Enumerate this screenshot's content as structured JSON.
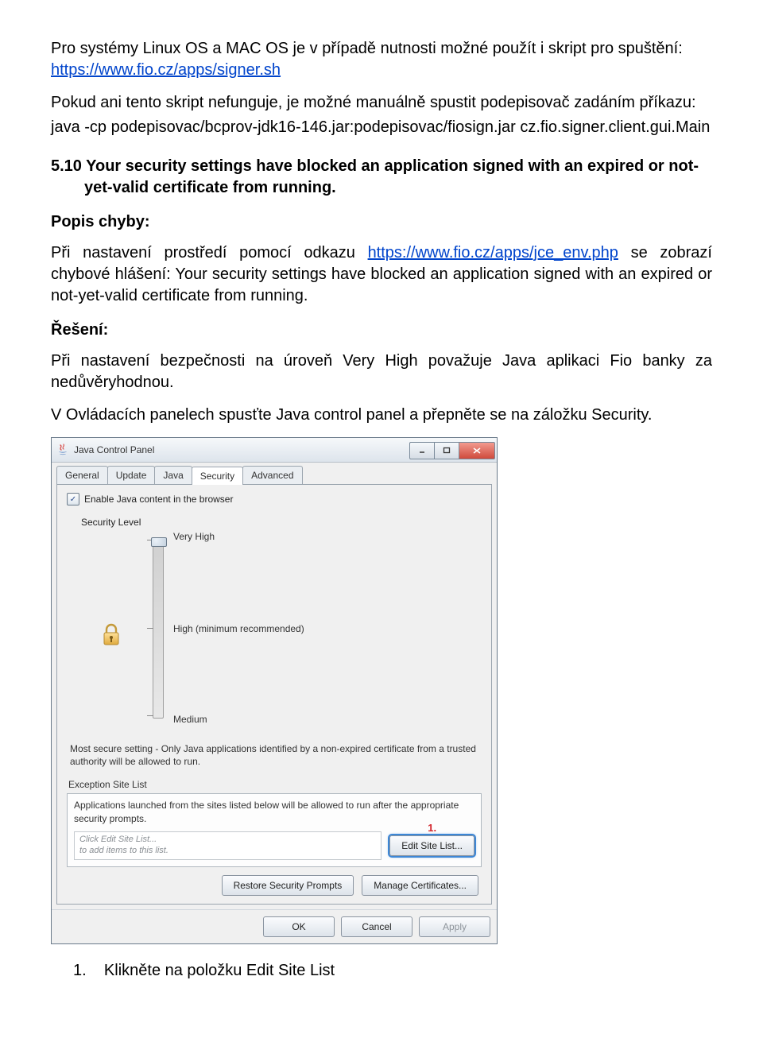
{
  "intro": {
    "p1a": "Pro systémy Linux OS a MAC OS je v případě nutnosti možné použít i skript pro spuštění:",
    "link1": "https://www.fio.cz/apps/signer.sh",
    "p2a": "Pokud ani tento skript nefunguje, je možné manuálně spustit podepisovač zadáním příkazu:",
    "cmd": "java -cp podepisovac/bcprov-jdk16-146.jar:podepisovac/fiosign.jar cz.fio.signer.client.gui.Main"
  },
  "section": {
    "num": "5.10",
    "title": "Your security settings have blocked an application signed with an expired or not-yet-valid certificate from running."
  },
  "labels": {
    "popis": "Popis chyby:",
    "reseni": "Řešení:"
  },
  "popis": {
    "p_a": "Při nastavení prostředí pomocí odkazu ",
    "link": "https://www.fio.cz/apps/jce_env.php",
    "p_b": " se zobrazí chybové hlášení: Your security settings have blocked an application signed with an expired or not-yet-valid certificate from running."
  },
  "reseni": {
    "p1": "Při nastavení bezpečnosti na úroveň Very High považuje Java aplikaci Fio banky za nedůvěryhodnou.",
    "p2": "V Ovládacích panelech spusťte Java control panel a přepněte se na záložku Security."
  },
  "win": {
    "title": "Java Control Panel",
    "tabs": [
      "General",
      "Update",
      "Java",
      "Security",
      "Advanced"
    ],
    "active_tab_index": 3,
    "enable_label": "Enable Java content in the browser",
    "security_level_label": "Security Level",
    "levels": {
      "very_high": "Very High",
      "high": "High (minimum recommended)",
      "medium": "Medium"
    },
    "desc": "Most secure setting - Only Java applications identified by a non-expired certificate from a trusted authority will be allowed to run.",
    "esl_label": "Exception Site List",
    "esl_desc": "Applications launched from the sites listed below will be allowed to run after the appropriate security prompts.",
    "esl_placeholder_l1": "Click Edit Site List...",
    "esl_placeholder_l2": "to add items to this list.",
    "edit_btn": "Edit Site List...",
    "callout1": "1.",
    "restore_btn": "Restore Security Prompts",
    "manage_btn": "Manage Certificates...",
    "ok": "OK",
    "cancel": "Cancel",
    "apply": "Apply"
  },
  "list": {
    "n1": "1.",
    "t1": "Klikněte na položku Edit Site List"
  }
}
